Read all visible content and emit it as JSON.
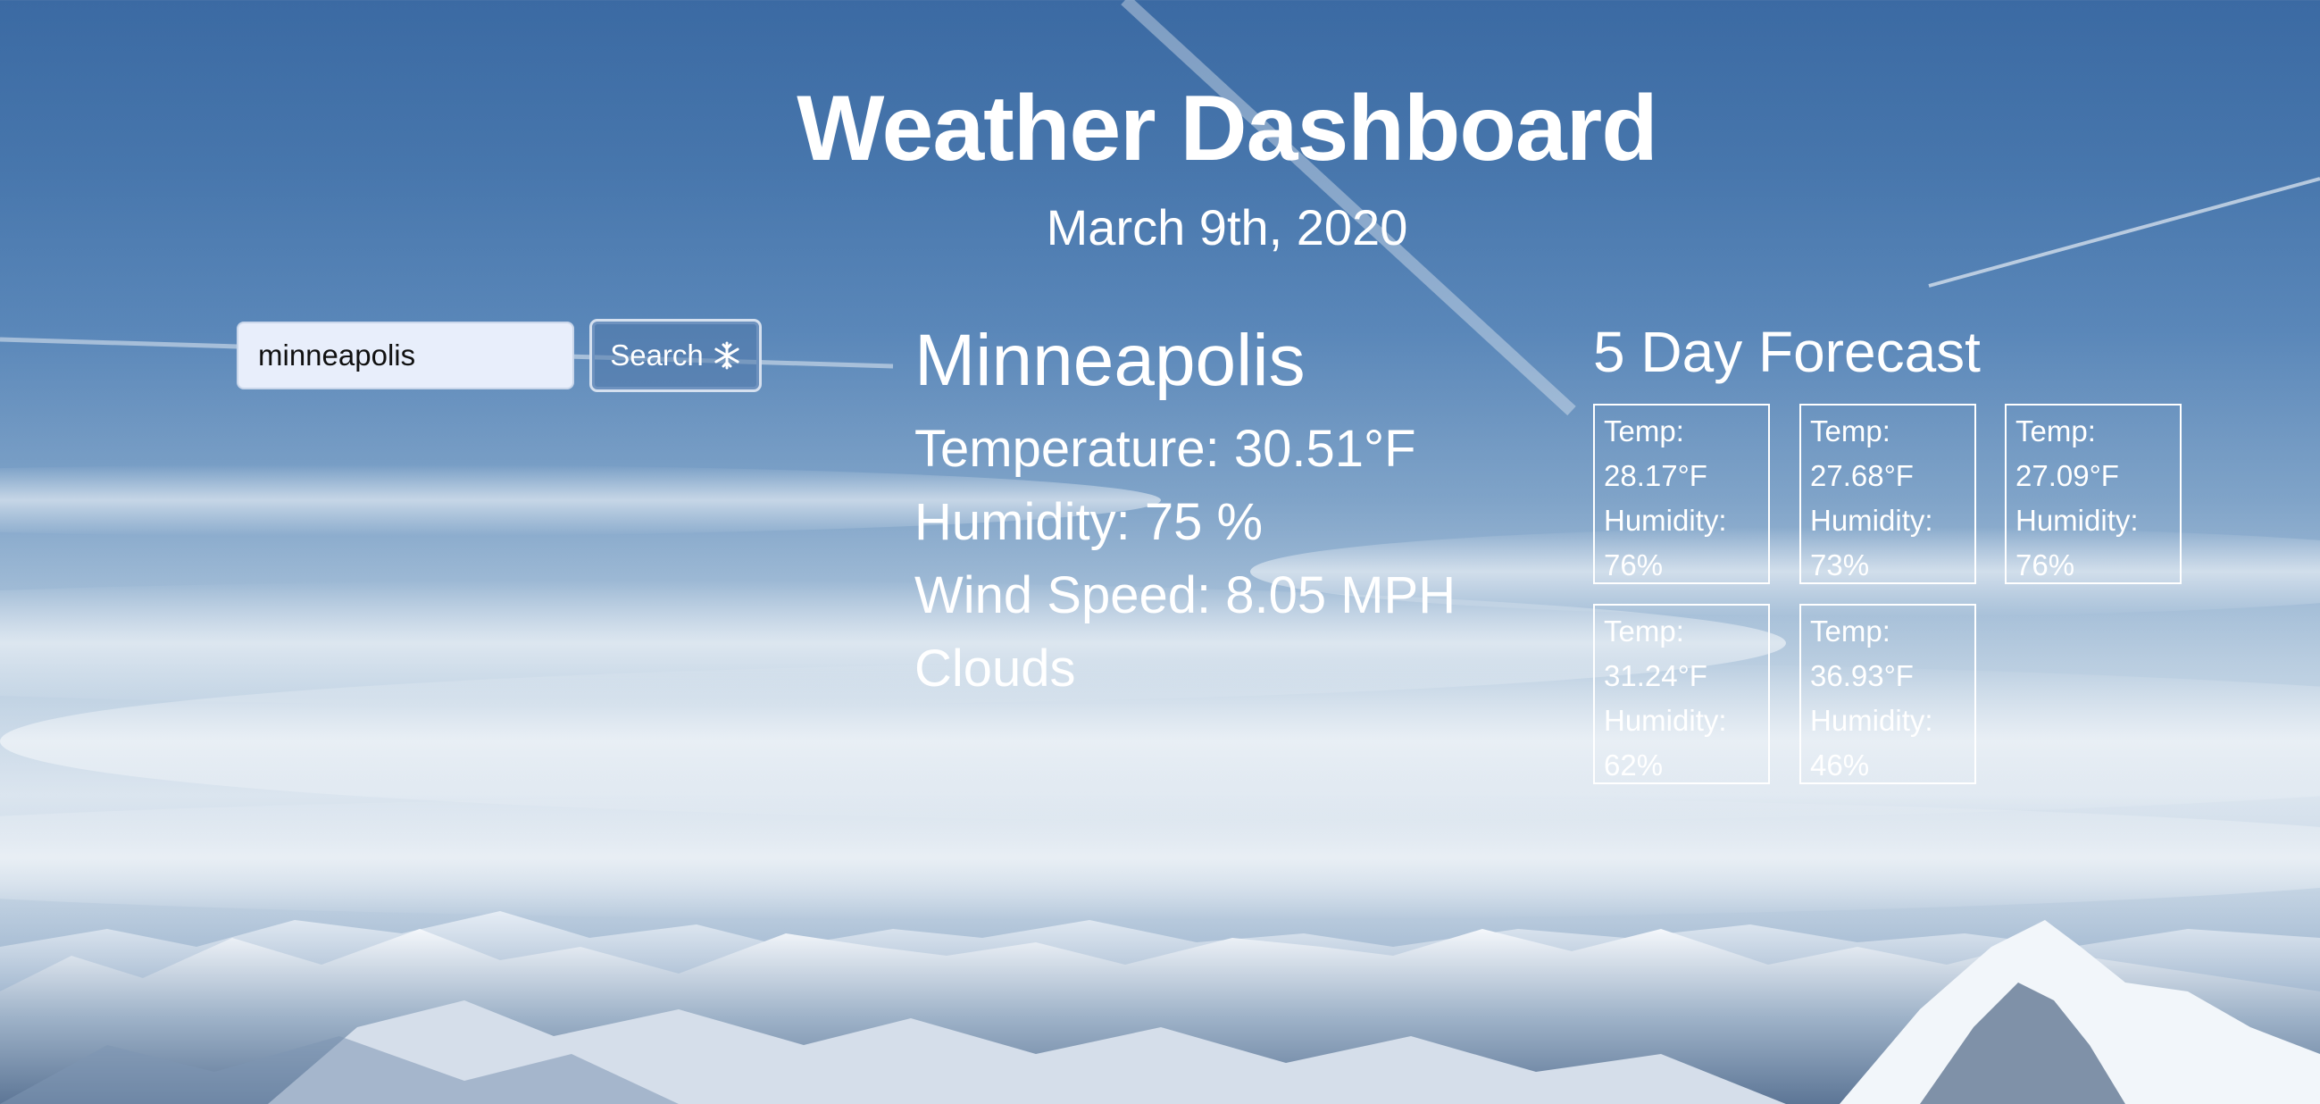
{
  "header": {
    "title": "Weather Dashboard",
    "date": "March 9th, 2020"
  },
  "search": {
    "value": "minneapolis",
    "button_label": "Search",
    "button_icon": "snowflake-icon"
  },
  "current": {
    "city": "Minneapolis",
    "temperature": "Temperature: 30.51°F",
    "humidity": "Humidity: 75 %",
    "wind": "Wind Speed: 8.05 MPH",
    "condition": "Clouds"
  },
  "forecast": {
    "title": "5 Day Forecast",
    "temp_label": "Temp:",
    "humidity_label": "Humidity:",
    "days": [
      {
        "temp": "28.17°F",
        "humidity": "76%"
      },
      {
        "temp": "27.68°F",
        "humidity": "73%"
      },
      {
        "temp": "27.09°F",
        "humidity": "76%"
      },
      {
        "temp": "31.24°F",
        "humidity": "62%"
      },
      {
        "temp": "36.93°F",
        "humidity": "46%"
      }
    ]
  }
}
